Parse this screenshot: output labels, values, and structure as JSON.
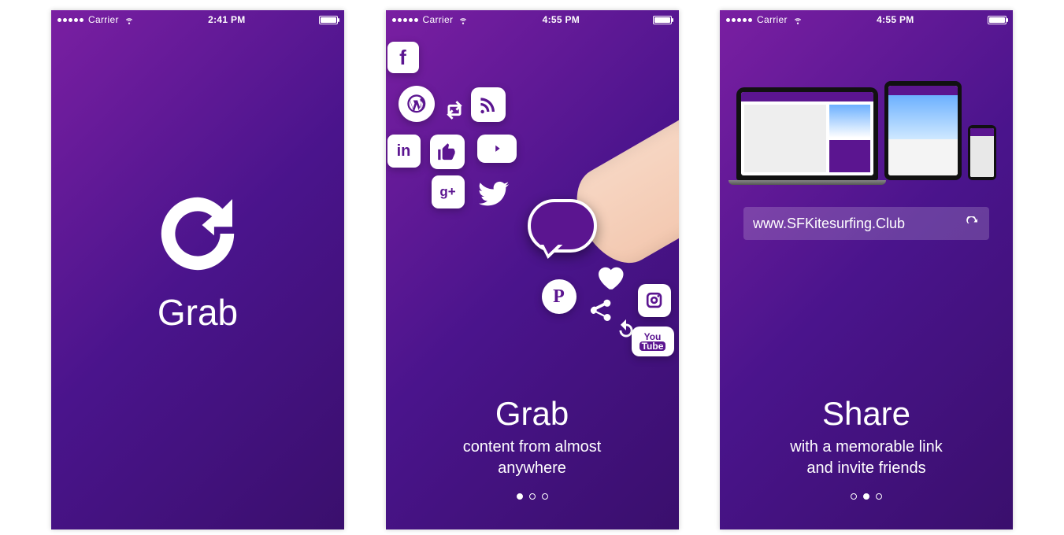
{
  "colors": {
    "brand_purple": "#5b1590",
    "white": "#ffffff"
  },
  "screens": [
    {
      "status": {
        "carrier": "Carrier",
        "time": "2:41 PM"
      },
      "app_name": "Grab"
    },
    {
      "status": {
        "carrier": "Carrier",
        "time": "4:55 PM"
      },
      "onboarding": {
        "title": "Grab",
        "subtitle": "content from almost\nanywhere",
        "page_index": 0,
        "page_count": 3
      },
      "social_icons": [
        "facebook-icon",
        "wordpress-icon",
        "retweet-icon",
        "rss-icon",
        "linkedin-icon",
        "like-thumb-icon",
        "youtube-play-icon",
        "google-plus-icon",
        "twitter-icon",
        "speech-bubble-icon",
        "heart-icon",
        "pinterest-icon",
        "share-icon",
        "refresh-icon",
        "instagram-icon",
        "youtube-text-icon"
      ]
    },
    {
      "status": {
        "carrier": "Carrier",
        "time": "4:55 PM"
      },
      "onboarding": {
        "title": "Share",
        "subtitle": "with a memorable link\nand invite friends",
        "page_index": 1,
        "page_count": 3
      },
      "url": "www.SFKitesurfing.Club",
      "devices": [
        "laptop",
        "tablet",
        "phone"
      ]
    }
  ]
}
